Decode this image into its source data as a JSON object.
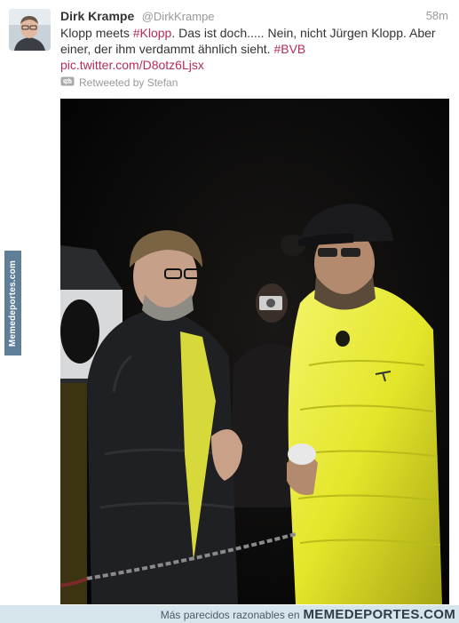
{
  "tweet": {
    "author_name": "Dirk Krampe",
    "author_handle": "@DirkKrampe",
    "time": "58m",
    "text_line1_pre": "Klopp meets ",
    "hashtag1": "#Klopp",
    "text_line1_post": ". Das ist doch..... Nein, nicht Jürgen Klopp. Aber",
    "text_line2": "einer, der ihm verdammt ähnlich sieht. ",
    "hashtag2": "#BVB",
    "pic_link": "pic.twitter.com/D8otz6Ljsx",
    "retweeted_by": "Retweeted by Stefan"
  },
  "watermark": {
    "side": "Memedeportes.com",
    "footer_caption": "Más parecidos razonables en",
    "footer_brand": "MEMEDEPORTES.COM"
  },
  "colors": {
    "link": "#b32d57",
    "photo_background": "#050506",
    "jacket_yellow": "#ecec2a",
    "footer_bar": "#d6e4ec"
  },
  "icons": {
    "retweet": "retweet-icon",
    "puma_logo": "puma-logo-icon",
    "bvb_badge": "bvb-badge-icon"
  }
}
